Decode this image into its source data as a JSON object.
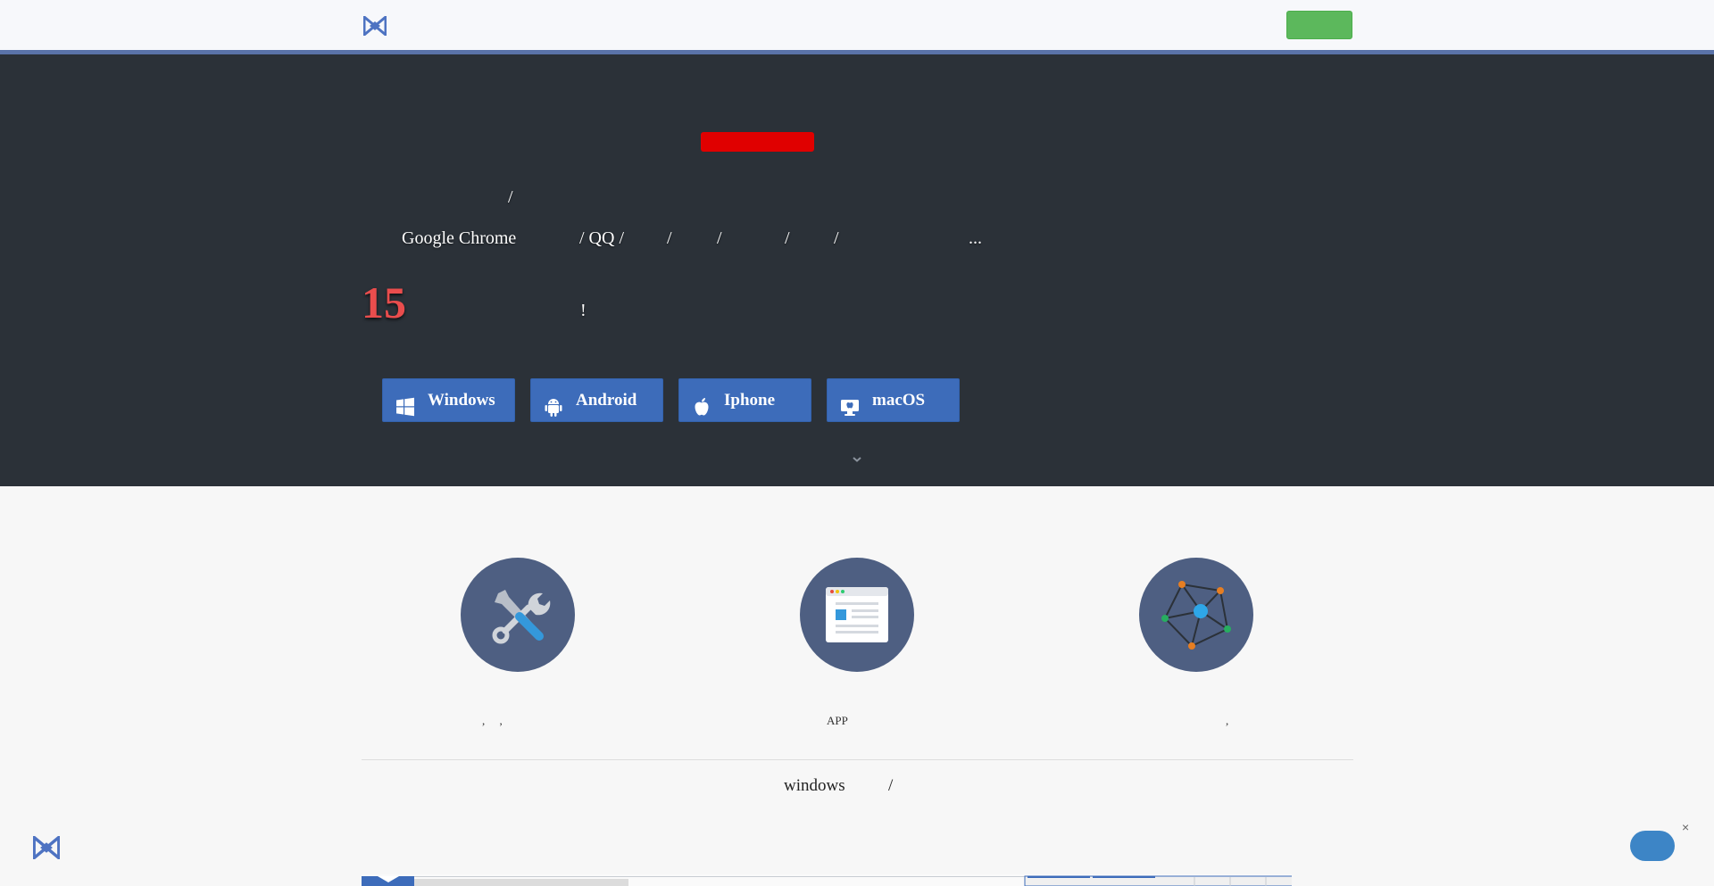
{
  "header": {
    "logo_icon": "bowtie-logo-icon",
    "login_label": ""
  },
  "hero": {
    "badge_label": "",
    "line1": "/",
    "line2_parts": [
      "Google Chrome",
      "/ QQ /",
      "/",
      "/",
      "/",
      "/",
      "..."
    ],
    "highlight_number": "15",
    "exclaim": "!",
    "scroll_icon": "chevron-down-icon",
    "download_buttons": [
      {
        "label": "Windows",
        "icon": "windows-icon"
      },
      {
        "label": "Android",
        "icon": "android-icon"
      },
      {
        "label": "Iphone",
        "icon": "apple-icon"
      },
      {
        "label": "macOS",
        "icon": "macos-icon"
      }
    ]
  },
  "features": [
    {
      "icon": "tools-icon",
      "text": ",     ,"
    },
    {
      "icon": "app-window-icon",
      "text": "APP"
    },
    {
      "icon": "network-icon",
      "text": ","
    }
  ],
  "section": {
    "title_word": "windows",
    "title_sep": "/"
  },
  "floating": {
    "logo_icon": "bowtie-logo-icon",
    "chat_icon": "chat-bubble-icon",
    "close_label": "×"
  },
  "colors": {
    "accent_blue": "#3d6cba",
    "hero_bg": "#2b3138",
    "login_green": "#5cb85c",
    "badge_red": "#e00000",
    "number_red": "#e94d4d",
    "feature_circle": "#4e5f82"
  }
}
